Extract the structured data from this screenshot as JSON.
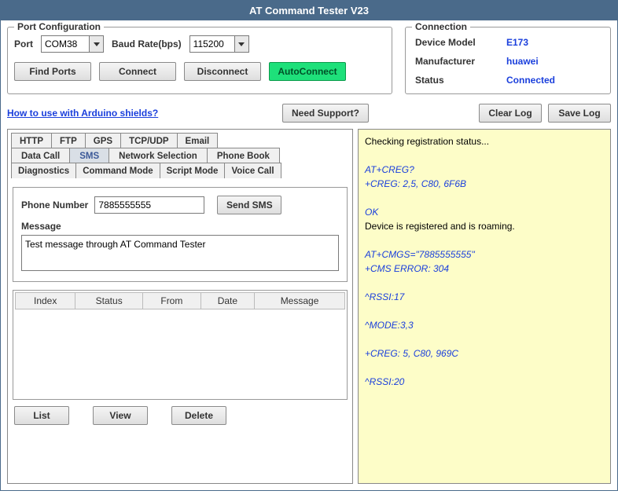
{
  "title": "AT Command Tester V23",
  "port_config": {
    "legend": "Port Configuration",
    "port_label": "Port",
    "port_value": "COM38",
    "baud_label": "Baud Rate(bps)",
    "baud_value": "115200",
    "find_ports": "Find Ports",
    "connect": "Connect",
    "disconnect": "Disconnect",
    "autoconnect": "AutoConnect"
  },
  "connection": {
    "legend": "Connection",
    "model_label": "Device Model",
    "model_value": "E173",
    "mfr_label": "Manufacturer",
    "mfr_value": "huawei",
    "status_label": "Status",
    "status_value": "Connected"
  },
  "links": {
    "arduino_link": "How to use with Arduino shields?",
    "need_support": "Need Support?",
    "clear_log": "Clear Log",
    "save_log": "Save Log"
  },
  "tabs": {
    "row1": [
      "HTTP",
      "FTP",
      "GPS",
      "TCP/UDP",
      "Email"
    ],
    "row2": [
      "Data Call",
      "SMS",
      "Network Selection",
      "Phone Book"
    ],
    "row3": [
      "Diagnostics",
      "Command Mode",
      "Script Mode",
      "Voice Call"
    ],
    "active": "SMS"
  },
  "sms": {
    "phone_label": "Phone Number",
    "phone_value": "7885555555",
    "send_btn": "Send SMS",
    "msg_label": "Message",
    "msg_value": "Test message through AT Command Tester",
    "cols": [
      "Index",
      "Status",
      "From",
      "Date",
      "Message"
    ],
    "list_btn": "List",
    "view_btn": "View",
    "delete_btn": "Delete"
  },
  "log": [
    {
      "cls": "log-black",
      "text": "Checking registration status..."
    },
    {
      "cls": "",
      "text": ""
    },
    {
      "cls": "log-blue",
      "text": "AT+CREG?"
    },
    {
      "cls": "log-blue",
      "text": "+CREG: 2,5, C80, 6F6B"
    },
    {
      "cls": "",
      "text": ""
    },
    {
      "cls": "log-blue",
      "text": "OK"
    },
    {
      "cls": "log-black",
      "text": "Device is registered and is roaming."
    },
    {
      "cls": "",
      "text": ""
    },
    {
      "cls": "log-blue",
      "text": "AT+CMGS=\"7885555555\""
    },
    {
      "cls": "log-blue",
      "text": "+CMS ERROR: 304"
    },
    {
      "cls": "",
      "text": ""
    },
    {
      "cls": "log-blue",
      "text": "^RSSI:17"
    },
    {
      "cls": "",
      "text": ""
    },
    {
      "cls": "log-blue",
      "text": "^MODE:3,3"
    },
    {
      "cls": "",
      "text": ""
    },
    {
      "cls": "log-blue",
      "text": "+CREG: 5, C80, 969C"
    },
    {
      "cls": "",
      "text": ""
    },
    {
      "cls": "log-blue",
      "text": "^RSSI:20"
    }
  ]
}
